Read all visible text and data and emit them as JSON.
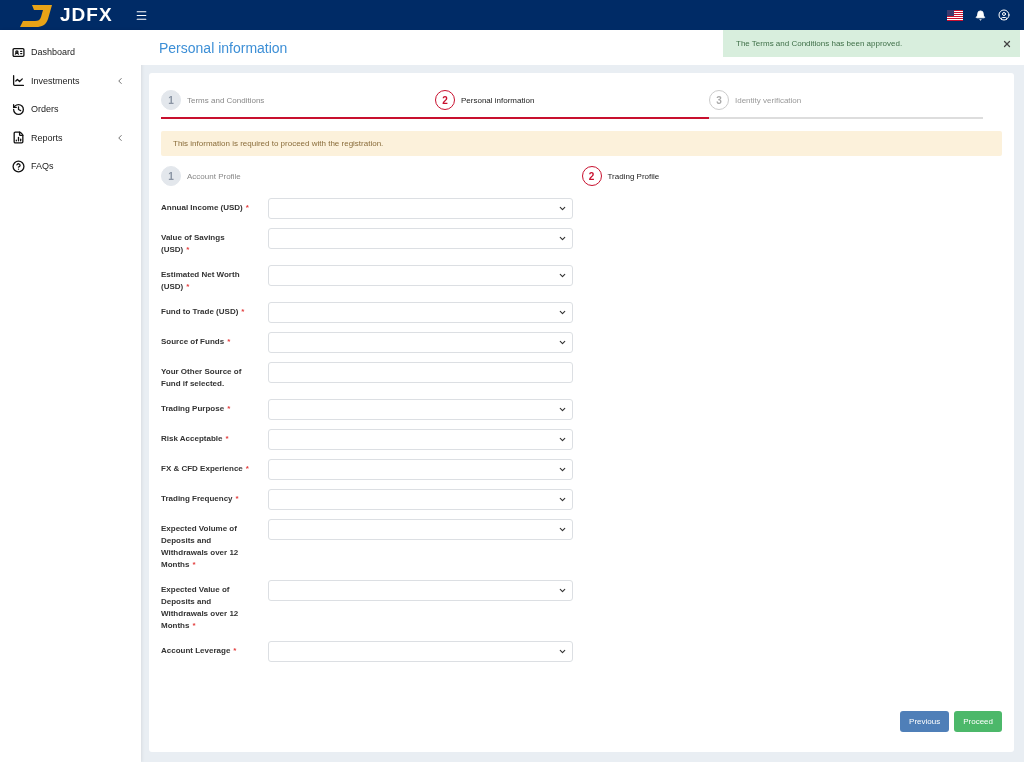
{
  "topbar": {
    "brand": "JDFX"
  },
  "sidebar": {
    "items": [
      {
        "label": "Dashboard",
        "kind": "dashboard",
        "expandable": false
      },
      {
        "label": "Investments",
        "kind": "investments",
        "expandable": true
      },
      {
        "label": "Orders",
        "kind": "orders",
        "expandable": false
      },
      {
        "label": "Reports",
        "kind": "reports",
        "expandable": true
      },
      {
        "label": "FAQs",
        "kind": "faqs",
        "expandable": false
      }
    ]
  },
  "page": {
    "title": "Personal information"
  },
  "toast": {
    "message": "The Terms and Conditions has been approved."
  },
  "steps": [
    {
      "number": "1",
      "label": "Terms and Conditions",
      "done": true,
      "selected": false
    },
    {
      "number": "2",
      "label": "Personal information",
      "done": false,
      "selected": true
    },
    {
      "number": "3",
      "label": "Identity verification",
      "done": false,
      "selected": false
    }
  ],
  "notice": "This information is required to proceed with the registration.",
  "substeps": [
    {
      "number": "1",
      "label": "Account Profile",
      "selected": false
    },
    {
      "number": "2",
      "label": "Trading Profile",
      "selected": true
    }
  ],
  "fields": [
    {
      "label": "Annual Income (USD)",
      "mark": "*",
      "kind": "select"
    },
    {
      "label": "Value of Savings (USD)",
      "mark": "*",
      "kind": "select"
    },
    {
      "label": "Estimated Net Worth (USD)",
      "mark": "*",
      "kind": "select"
    },
    {
      "label": "Fund to Trade (USD)",
      "mark": "*",
      "kind": "select"
    },
    {
      "label": "Source of Funds",
      "mark": "*",
      "kind": "select"
    },
    {
      "label": "Your Other Source of Fund if selected.",
      "kind": "text"
    },
    {
      "label": "Trading Purpose",
      "mark": "*",
      "kind": "select"
    },
    {
      "label": "Risk Acceptable",
      "mark": "*",
      "kind": "select"
    },
    {
      "label": "FX & CFD Experience",
      "mark": "*",
      "kind": "select"
    },
    {
      "label": "Trading Frequency",
      "mark": "*",
      "kind": "select"
    },
    {
      "label": "Expected Volume of Deposits and Withdrawals over 12 Months",
      "mark": "*",
      "kind": "select"
    },
    {
      "label": "Expected Value of Deposits and Withdrawals over 12 Months",
      "mark": "*",
      "kind": "select"
    },
    {
      "label": "Account Leverage",
      "mark": "*",
      "kind": "select"
    }
  ],
  "buttons": [
    {
      "label": "Previous",
      "kind": "secondary"
    },
    {
      "label": "Proceed",
      "kind": "primary"
    }
  ]
}
